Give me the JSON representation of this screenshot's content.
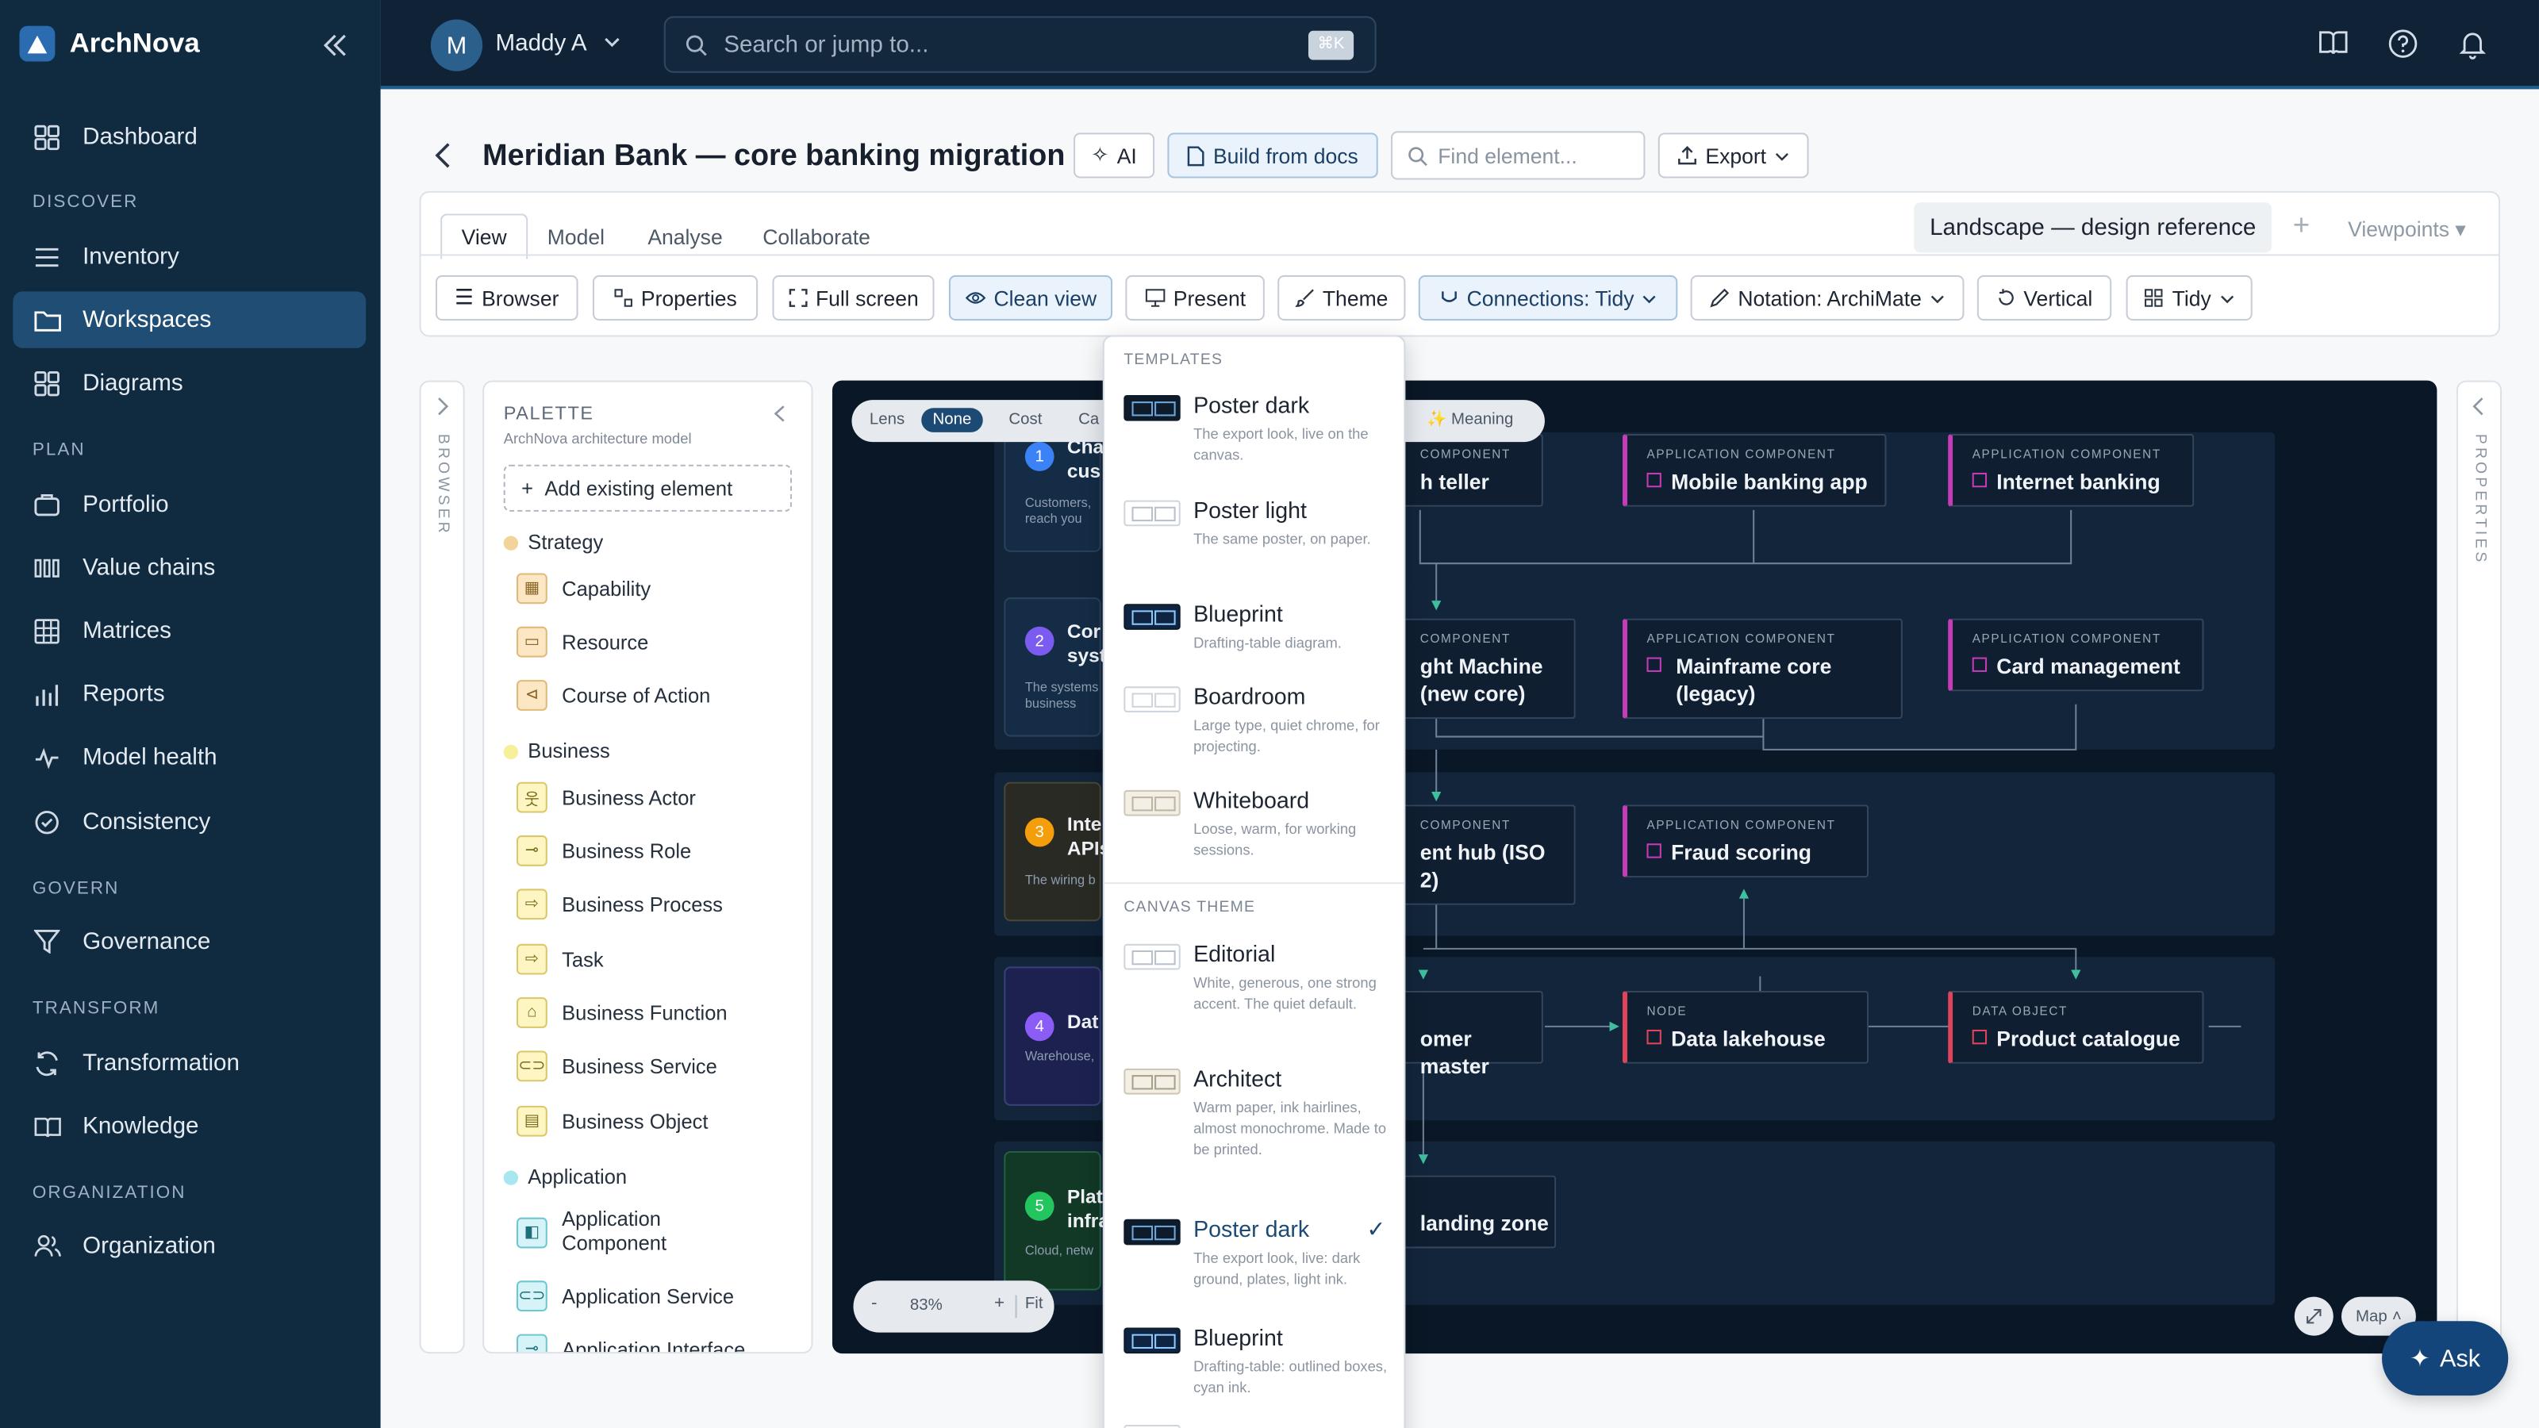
{
  "app": {
    "name": "ArchNova"
  },
  "sidebar": {
    "sections": {
      "discover": "DISCOVER",
      "plan": "PLAN",
      "govern": "GOVERN",
      "transform": "TRANSFORM",
      "organization": "ORGANIZATION"
    },
    "items": [
      {
        "label": "Dashboard",
        "icon": "dashboard-icon"
      },
      {
        "label": "Inventory",
        "icon": "list-icon"
      },
      {
        "label": "Workspaces",
        "icon": "folder-icon"
      },
      {
        "label": "Diagrams",
        "icon": "grid-icon"
      },
      {
        "label": "Portfolio",
        "icon": "briefcase-icon"
      },
      {
        "label": "Value chains",
        "icon": "bars-icon"
      },
      {
        "label": "Matrices",
        "icon": "table-icon"
      },
      {
        "label": "Reports",
        "icon": "chart-icon"
      },
      {
        "label": "Model health",
        "icon": "pulse-icon"
      },
      {
        "label": "Consistency",
        "icon": "check-circle-icon"
      },
      {
        "label": "Governance",
        "icon": "filter-icon"
      },
      {
        "label": "Transformation",
        "icon": "refresh-icon"
      },
      {
        "label": "Knowledge",
        "icon": "book-icon"
      },
      {
        "label": "Organization",
        "icon": "users-icon"
      }
    ],
    "active": "Workspaces"
  },
  "topbar": {
    "avatar_initial": "M",
    "user_name": "Maddy A",
    "search_placeholder": "Search or jump to...",
    "shortcut": "⌘K"
  },
  "header": {
    "title": "Meridian Bank — core banking migration",
    "ai_label": "AI",
    "build_label": "Build from docs",
    "find_placeholder": "Find element...",
    "export_label": "Export"
  },
  "tabs": {
    "items": [
      "View",
      "Model",
      "Analyse",
      "Collaborate"
    ],
    "active": "View",
    "viewpoint": "Landscape — design reference",
    "viewpoints_label": "Viewpoints"
  },
  "toolbar": {
    "browser": "Browser",
    "properties": "Properties",
    "fullscreen": "Full screen",
    "clean_view": "Clean view",
    "present": "Present",
    "theme": "Theme",
    "connections": "Connections: Tidy",
    "notation": "Notation: ArchiMate",
    "vertical": "Vertical",
    "tidy": "Tidy"
  },
  "rails": {
    "browser": "BROWSER",
    "properties": "PROPERTIES"
  },
  "palette": {
    "title": "PALETTE",
    "subtitle": "ArchNova architecture model",
    "add_existing": "Add existing element",
    "groups": [
      {
        "name": "Strategy",
        "color": "#f2d49a",
        "items": [
          "Capability",
          "Resource",
          "Course of Action"
        ]
      },
      {
        "name": "Business",
        "color": "#f7ef9a",
        "items": [
          "Business Actor",
          "Business Role",
          "Business Process",
          "Task",
          "Business Function",
          "Business Service",
          "Business Object"
        ]
      },
      {
        "name": "Application",
        "color": "#a8e6f0",
        "items": [
          "Application Component",
          "Application Service",
          "Application Interface"
        ]
      }
    ]
  },
  "canvas": {
    "lens": {
      "label": "Lens",
      "options": [
        "None",
        "Cost",
        "Ca"
      ],
      "selected": "None",
      "meaning": "✨ Meaning"
    },
    "zoom": {
      "minus": "-",
      "value": "83%",
      "plus": "+",
      "fit": "Fit"
    },
    "map_label": "Map",
    "plates": [
      {
        "num": "1",
        "title": "Cha\ncus",
        "sub": "Customers,\nreach you",
        "color": "#3b82f6"
      },
      {
        "num": "2",
        "title": "Cor\nsyst",
        "sub": "The systems\nbusiness",
        "color": "#7c5cf0"
      },
      {
        "num": "3",
        "title": "Inte\nAPIs",
        "sub": "The wiring b",
        "color": "#f59e0b"
      },
      {
        "num": "4",
        "title": "Dat",
        "sub": "Warehouse,",
        "color": "#8b5cf6"
      },
      {
        "num": "5",
        "title": "Plat\ninfra",
        "sub": "Cloud, netw",
        "color": "#22c55e"
      }
    ],
    "nodes": [
      {
        "kind": "COMPONENT",
        "name": "h teller"
      },
      {
        "kind": "APPLICATION COMPONENT",
        "name": "Mobile banking app"
      },
      {
        "kind": "APPLICATION COMPONENT",
        "name": "Internet banking"
      },
      {
        "kind": "COMPONENT",
        "name": "ght Machine\n(new core)"
      },
      {
        "kind": "APPLICATION COMPONENT",
        "name": "Mainframe core\n(legacy)"
      },
      {
        "kind": "APPLICATION COMPONENT",
        "name": "Card management"
      },
      {
        "kind": "COMPONENT",
        "name": "ent hub (ISO\n2)"
      },
      {
        "kind": "APPLICATION COMPONENT",
        "name": "Fraud scoring"
      },
      {
        "kind": "",
        "name": "omer master"
      },
      {
        "kind": "NODE",
        "name": "Data lakehouse"
      },
      {
        "kind": "DATA OBJECT",
        "name": "Product catalogue"
      },
      {
        "kind": "",
        "name": "landing zone"
      }
    ]
  },
  "theme_menu": {
    "templates_label": "TEMPLATES",
    "canvas_label": "CANVAS THEME",
    "templates": [
      {
        "name": "Poster dark",
        "desc": "The export look, live on the canvas."
      },
      {
        "name": "Poster light",
        "desc": "The same poster, on paper."
      },
      {
        "name": "Blueprint",
        "desc": "Drafting-table diagram."
      },
      {
        "name": "Boardroom",
        "desc": "Large type, quiet chrome, for projecting."
      },
      {
        "name": "Whiteboard",
        "desc": "Loose, warm, for working sessions."
      }
    ],
    "canvas_themes": [
      {
        "name": "Editorial",
        "desc": "White, generous, one strong accent. The quiet default."
      },
      {
        "name": "Architect",
        "desc": "Warm paper, ink hairlines, almost monochrome. Made to be printed."
      },
      {
        "name": "Poster dark",
        "desc": "The export look, live: dark ground, plates, light ink."
      },
      {
        "name": "Blueprint",
        "desc": "Drafting-table: outlined boxes, cyan ink."
      }
    ],
    "selected": "Poster dark"
  },
  "ask": {
    "label": "Ask"
  }
}
